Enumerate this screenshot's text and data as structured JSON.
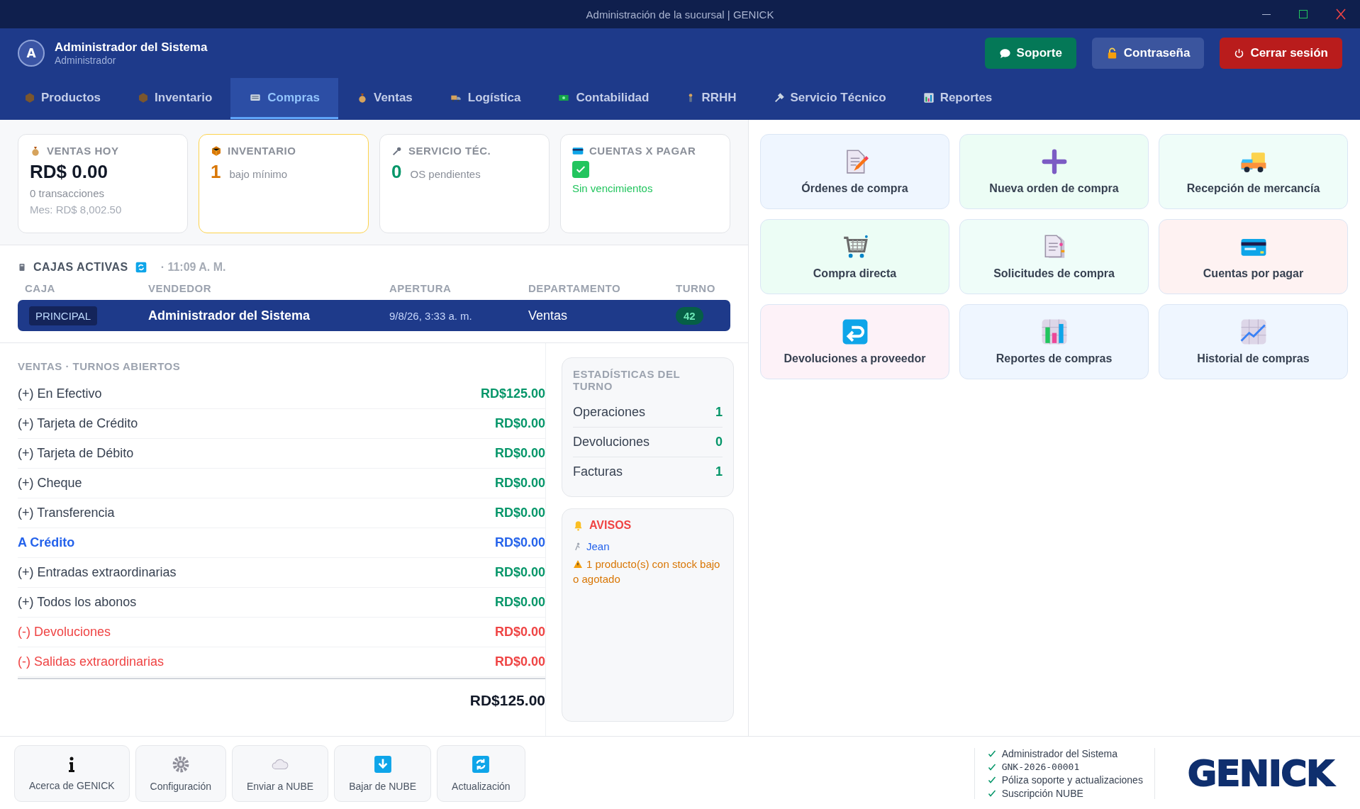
{
  "window": {
    "title": "Administración de la sucursal | GENICK"
  },
  "user": {
    "initial": "A",
    "name": "Administrador del Sistema",
    "role": "Administrador"
  },
  "header_buttons": [
    {
      "label": "Soporte",
      "kind": "support"
    },
    {
      "label": "Contraseña",
      "kind": "password"
    },
    {
      "label": "Cerrar sesión",
      "kind": "logout"
    }
  ],
  "tabs": [
    {
      "label": "Productos",
      "selected": false
    },
    {
      "label": "Inventario",
      "selected": false
    },
    {
      "label": "Compras",
      "selected": true
    },
    {
      "label": "Ventas",
      "selected": false
    },
    {
      "label": "Logística",
      "selected": false
    },
    {
      "label": "Contabilidad",
      "selected": false
    },
    {
      "label": "RRHH",
      "selected": false
    },
    {
      "label": "Servicio Técnico",
      "selected": false
    },
    {
      "label": "Reportes",
      "selected": false
    }
  ],
  "stat_cards": [
    {
      "kind": "money",
      "title": "VENTAS HOY",
      "highlighted": false,
      "value": "RD$ 0.00",
      "detail": "0 transacciones",
      "note": "Mes: RD$ 8,002.50"
    },
    {
      "kind": "count",
      "title": "INVENTARIO",
      "highlighted": true,
      "value": "1",
      "detail": "bajo mínimo",
      "color": "#d97706"
    },
    {
      "kind": "count",
      "title": "SERVICIO TÉC.",
      "highlighted": false,
      "value": "0",
      "detail": "OS pendientes",
      "color": "#059669"
    },
    {
      "kind": "check",
      "title": "CUENTAS X PAGAR",
      "highlighted": false,
      "detail": "Sin vencimientos"
    }
  ],
  "cajas": {
    "title": "CAJAS ACTIVAS",
    "time": "· 11:09 A. M.",
    "columns": [
      "CAJA",
      "VENDEDOR",
      "APERTURA",
      "DEPARTAMENTO",
      "TURNO"
    ],
    "rows": [
      {
        "caja": "PRINCIPAL",
        "vendedor": "Administrador del Sistema",
        "apertura": "9/8/26, 3:33 a. m.",
        "departamento": "Ventas",
        "turno": "42"
      }
    ]
  },
  "ventas": {
    "title": "VENTAS · TURNOS ABIERTOS",
    "rows": [
      {
        "kind": "plus",
        "label": "(+) En Efectivo",
        "amount": "RD$125.00"
      },
      {
        "kind": "plus",
        "label": "(+) Tarjeta de Crédito",
        "amount": "RD$0.00"
      },
      {
        "kind": "plus",
        "label": "(+) Tarjeta de Débito",
        "amount": "RD$0.00"
      },
      {
        "kind": "plus",
        "label": "(+) Cheque",
        "amount": "RD$0.00"
      },
      {
        "kind": "plus",
        "label": "(+) Transferencia",
        "amount": "RD$0.00"
      },
      {
        "kind": "credit",
        "label": "A Crédito",
        "amount": "RD$0.00"
      },
      {
        "kind": "plus",
        "label": "(+) Entradas extraordinarias",
        "amount": "RD$0.00"
      },
      {
        "kind": "plus",
        "label": "(+) Todos los abonos",
        "amount": "RD$0.00"
      },
      {
        "kind": "minus",
        "label": "(-) Devoluciones",
        "amount": "RD$0.00"
      },
      {
        "kind": "minus",
        "label": "(-) Salidas extraordinarias",
        "amount": "RD$0.00"
      }
    ],
    "total": "RD$125.00"
  },
  "estadisticas": {
    "title": "ESTADÍSTICAS DEL TURNO",
    "rows": [
      {
        "label": "Operaciones",
        "value": "1"
      },
      {
        "label": "Devoluciones",
        "value": "0"
      },
      {
        "label": "Facturas",
        "value": "1"
      }
    ]
  },
  "avisos": {
    "title": "AVISOS",
    "user": "Jean",
    "warning": "1 producto(s) con stock bajo o agotado"
  },
  "tiles": [
    {
      "label": "Órdenes de compra",
      "color": "#eff6ff"
    },
    {
      "label": "Nueva orden de compra",
      "color": "#ecfdf5"
    },
    {
      "label": "Recepción de mercancía",
      "color": "#effdf9"
    },
    {
      "label": "Compra directa",
      "color": "#ecfdf5"
    },
    {
      "label": "Solicitudes de compra",
      "color": "#effdf9"
    },
    {
      "label": "Cuentas por pagar",
      "color": "#fef2f2"
    },
    {
      "label": "Devoluciones a proveedor",
      "color": "#fdf2f8"
    },
    {
      "label": "Reportes de compras",
      "color": "#eff6ff"
    },
    {
      "label": "Historial de compras",
      "color": "#eff6ff"
    }
  ],
  "footer_buttons": [
    {
      "label": "Acerca de GENICK"
    },
    {
      "label": "Configuración"
    },
    {
      "label": "Enviar a NUBE"
    },
    {
      "label": "Bajar de NUBE"
    },
    {
      "label": "Actualización"
    }
  ],
  "license": [
    {
      "text": "Administrador del Sistema",
      "kind": "text"
    },
    {
      "text": "GNK-2026-00001",
      "kind": "code"
    },
    {
      "text": "Póliza soporte y actualizaciones",
      "kind": "text"
    },
    {
      "text": "Suscripción NUBE",
      "kind": "text"
    }
  ],
  "logo": "GENICK"
}
